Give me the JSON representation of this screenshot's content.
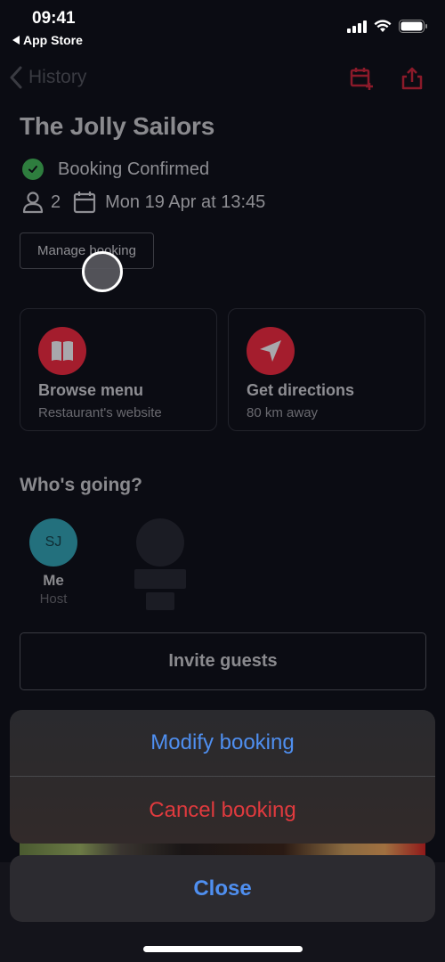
{
  "status_bar": {
    "time": "09:41",
    "back_app": "App Store"
  },
  "nav": {
    "back_label": "History",
    "icons": [
      "calendar-add-icon",
      "share-icon"
    ],
    "accent_color": "#8b1a2a"
  },
  "booking": {
    "restaurant_name": "The Jolly Sailors",
    "status": "Booking Confirmed",
    "guests": "2",
    "datetime": "Mon 19 Apr at 13:45",
    "manage_label": "Manage booking"
  },
  "cards": [
    {
      "title": "Browse menu",
      "subtitle": "Restaurant's website",
      "icon": "book-icon"
    },
    {
      "title": "Get directions",
      "subtitle": "80 km away",
      "icon": "navigation-arrow-icon"
    }
  ],
  "guests_section": {
    "heading": "Who's going?",
    "guests": [
      {
        "initials": "SJ",
        "name": "Me",
        "role": "Host"
      }
    ],
    "invite_label": "Invite guests"
  },
  "action_sheet": {
    "modify_label": "Modify booking",
    "cancel_label": "Cancel booking",
    "close_label": "Close",
    "modify_color": "#4f8ff0",
    "cancel_color": "#e03a3e"
  }
}
